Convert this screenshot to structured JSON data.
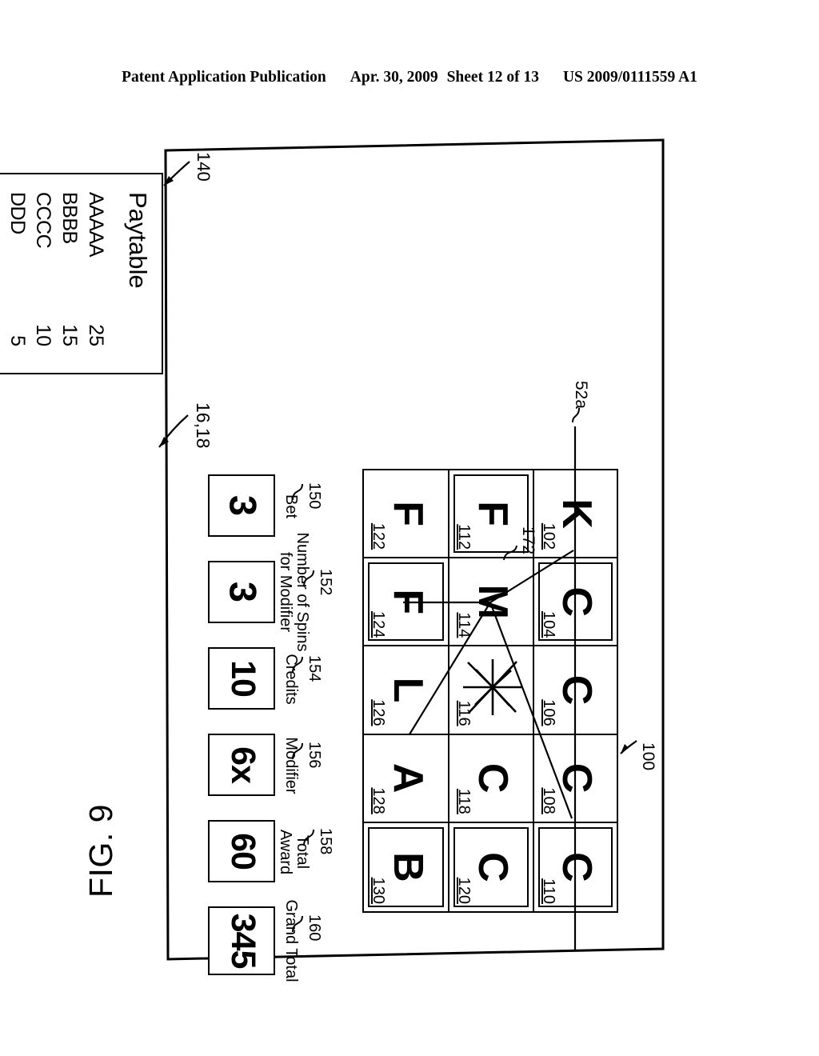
{
  "header": {
    "publication": "Patent Application Publication",
    "date": "Apr. 30, 2009",
    "sheet": "Sheet 12 of 13",
    "docnum": "US 2009/0111559 A1"
  },
  "figure": {
    "label": "FIG. 9",
    "frame_ref": "16,18",
    "payline_ref": "52a",
    "grid_ref": "100",
    "wild_ref": "172"
  },
  "paytable": {
    "ref": "140",
    "title": "Paytable",
    "rows": [
      {
        "symbol": "AAAAA",
        "value": "25"
      },
      {
        "symbol": "BBBB",
        "value": "15"
      },
      {
        "symbol": "CCCC",
        "value": "10"
      },
      {
        "symbol": "DDD",
        "value": "5"
      }
    ]
  },
  "reels": {
    "ref": "100",
    "rows": 3,
    "cols": 5,
    "cells": [
      {
        "symbol": "K",
        "ref": "102",
        "highlight": false
      },
      {
        "symbol": "C",
        "ref": "104",
        "highlight": true
      },
      {
        "symbol": "C",
        "ref": "106",
        "highlight": false
      },
      {
        "symbol": "C",
        "ref": "108",
        "highlight": false
      },
      {
        "symbol": "C",
        "ref": "110",
        "highlight": true
      },
      {
        "symbol": "F",
        "ref": "112",
        "highlight": true
      },
      {
        "symbol": "M",
        "ref": "114",
        "highlight": false
      },
      {
        "symbol": "starburst-icon",
        "ref": "116",
        "highlight": false
      },
      {
        "symbol": "C",
        "ref": "118",
        "highlight": false
      },
      {
        "symbol": "C",
        "ref": "120",
        "highlight": true
      },
      {
        "symbol": "F",
        "ref": "122",
        "highlight": false
      },
      {
        "symbol": "F",
        "ref": "124",
        "highlight": true
      },
      {
        "symbol": "L",
        "ref": "126",
        "highlight": false
      },
      {
        "symbol": "A",
        "ref": "128",
        "highlight": false
      },
      {
        "symbol": "B",
        "ref": "130",
        "highlight": true
      }
    ]
  },
  "meters": [
    {
      "ref": "150",
      "label": "Bet",
      "value": "3"
    },
    {
      "ref": "152",
      "label": "Number of Spins\nfor Modifier",
      "label_line1": "Number of Spins",
      "label_line2": "for Modifier",
      "value": "3"
    },
    {
      "ref": "154",
      "label": "Credits",
      "value": "10"
    },
    {
      "ref": "156",
      "label": "Modifier",
      "value": "6x"
    },
    {
      "ref": "158",
      "label": "Total Award",
      "label_line1": "Total",
      "label_line2": "Award",
      "value": "60"
    },
    {
      "ref": "160",
      "label": "Grand Total",
      "value": "345"
    }
  ],
  "colors": {
    "ink": "#000000",
    "paper": "#ffffff"
  }
}
